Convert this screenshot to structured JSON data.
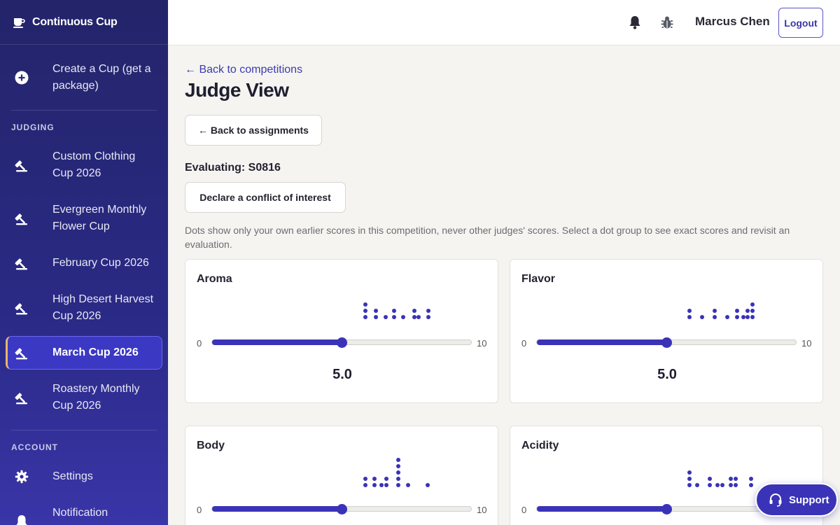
{
  "brand": {
    "name": "Continuous Cup"
  },
  "sidebar": {
    "create": {
      "label": "Create a Cup (get a package)",
      "icon": "plus-circle-icon"
    },
    "judging_label": "JUDGING",
    "judging_items": [
      {
        "label": "Custom Clothing Cup 2026",
        "icon": "gavel-icon"
      },
      {
        "label": "Evergreen Monthly Flower Cup",
        "icon": "gavel-icon"
      },
      {
        "label": "February Cup 2026",
        "icon": "gavel-icon"
      },
      {
        "label": "High Desert Harvest Cup 2026",
        "icon": "gavel-icon"
      },
      {
        "label": "March Cup 2026",
        "icon": "gavel-icon",
        "active": true
      },
      {
        "label": "Roastery Monthly Cup 2026",
        "icon": "gavel-icon"
      }
    ],
    "account_label": "ACCOUNT",
    "account_items": [
      {
        "label": "Settings",
        "icon": "gear-icon"
      },
      {
        "label": "Notification",
        "icon": "bell-icon"
      }
    ]
  },
  "header": {
    "user_name": "Marcus Chen",
    "logout_label": "Logout",
    "icons": [
      "bell-icon",
      "bug-icon"
    ]
  },
  "main": {
    "back_link": "← Back to competitions",
    "title": "Judge View",
    "back_assignments": "← Back to assignments",
    "evaluating": "Evaluating: S0816",
    "conflict_button": "Declare a conflict of interest",
    "hint": "Dots show only your own earlier scores in this competition, never other judges' scores. Select a dot group to see exact scores and revisit an evaluation.",
    "criteria": [
      {
        "name": "Aroma",
        "min": "0",
        "max": "10",
        "value": 5.0,
        "score": "5.0"
      },
      {
        "name": "Flavor",
        "min": "0",
        "max": "10",
        "value": 5.0,
        "score": "5.0"
      },
      {
        "name": "Body",
        "min": "0",
        "max": "10",
        "value": 5.0,
        "score": "5.0"
      },
      {
        "name": "Acidity",
        "min": "0",
        "max": "10",
        "value": 5.0,
        "score": "5.0"
      }
    ]
  },
  "support": {
    "label": "Support",
    "icon": "headset-icon"
  },
  "colors": {
    "accent": "#3a33b8",
    "sidebar": "#2a2a86",
    "active_marker": "#e9b46a"
  }
}
